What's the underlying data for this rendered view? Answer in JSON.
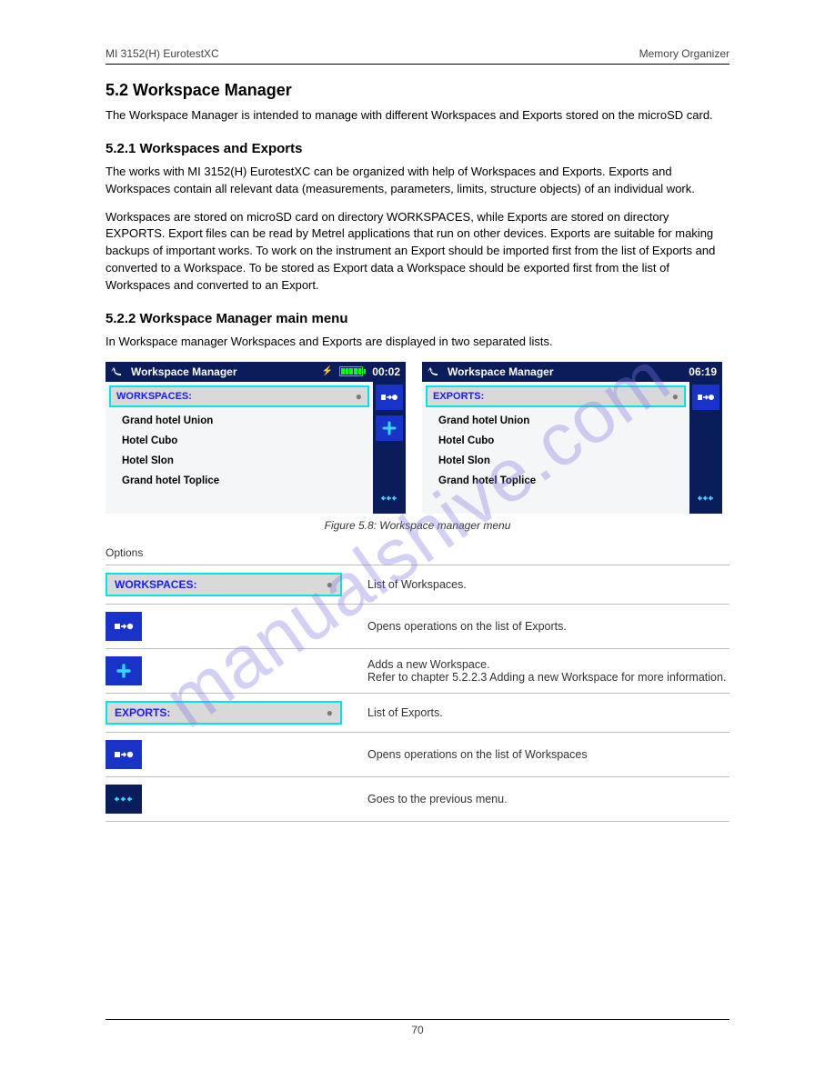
{
  "header": {
    "left": "MI 3152(H) EurotestXC",
    "right": "Memory Organizer"
  },
  "footer": {
    "page": "70"
  },
  "section": {
    "num_title": "5.2 Workspace Manager",
    "p1": "The Workspace Manager is intended to manage with different Workspaces and Exports stored on the microSD card.",
    "sub1_title": "5.2.1 Workspaces and Exports",
    "p2": "The works with MI 3152(H) EurotestXC can be organized with help of Workspaces and Exports. Exports and Workspaces contain all relevant data (measurements, parameters, limits, structure objects) of an individual work.",
    "p3": "Workspaces are stored on microSD card on directory WORKSPACES, while Exports are stored on directory EXPORTS. Export files can be read by Metrel applications that run on other devices. Exports are suitable for making backups of important works. To work on the instrument an Export should be imported first from the list of Exports and converted to a Workspace. To be stored as Export data a Workspace should be exported first from the list of Workspaces and converted to an Export.",
    "sub2_title": "5.2.2 Workspace Manager main menu",
    "p4": "In Workspace manager Workspaces and Exports are displayed in two separated lists."
  },
  "device_left": {
    "title": "Workspace Manager",
    "time": "00:02",
    "chip_label": "WORKSPACES:",
    "chip_dot": "●",
    "items": [
      "Grand hotel Union",
      "Hotel Cubo",
      "Hotel Slon",
      "Grand hotel Toplice"
    ]
  },
  "device_right": {
    "title": "Workspace Manager",
    "time": "06:19",
    "chip_label": "EXPORTS:",
    "chip_dot": "●",
    "items": [
      "Grand hotel Union",
      "Hotel Cubo",
      "Hotel Slon",
      "Grand hotel Toplice"
    ]
  },
  "figcap": "Figure 5.8: Workspace manager menu",
  "options_hdr": "Options",
  "opts": {
    "workspaces": {
      "chip_label": "WORKSPACES:",
      "chip_dot": "●",
      "desc": "List of Workspaces."
    },
    "toggle1": {
      "desc": "Opens operations on the list of Exports."
    },
    "add": {
      "desc": "Adds a new Workspace.\nRefer to chapter 5.2.2.3 Adding a new Workspace for more information."
    },
    "exports": {
      "chip_label": "EXPORTS:",
      "chip_dot": "●",
      "desc": "List of Exports."
    },
    "toggle2": {
      "desc": "Opens operations on the list of Workspaces"
    },
    "prev": {
      "desc": "Goes to the previous menu."
    }
  },
  "watermark": "manualshive.com"
}
